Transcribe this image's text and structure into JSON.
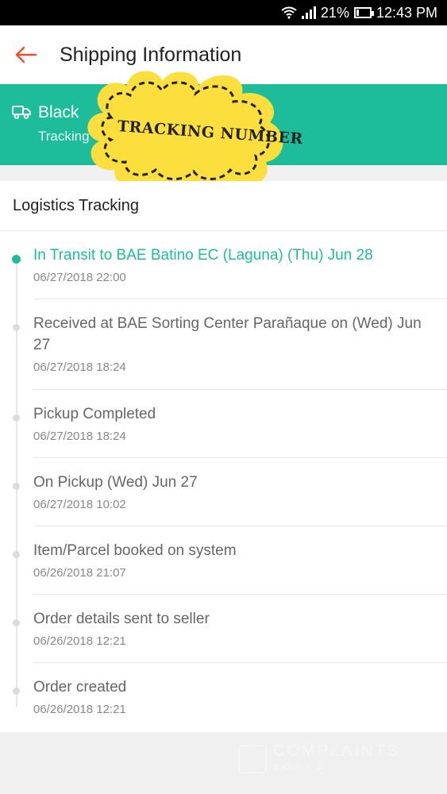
{
  "status_bar": {
    "battery": "21%",
    "time": "12:43 PM",
    "battery_level": 0.21
  },
  "app_bar": {
    "title": "Shipping Information",
    "back_icon": "arrow-left-icon"
  },
  "shipment": {
    "courier": "Black",
    "tracking_label": "Tracking",
    "icon": "truck-icon"
  },
  "sticker": {
    "text": "TRACKING NUMBER"
  },
  "logistics": {
    "header": "Logistics Tracking",
    "events": [
      {
        "status": "In Transit to BAE Batino EC (Laguna) (Thu) Jun 28",
        "time": "06/27/2018 22:00",
        "current": true
      },
      {
        "status": "Received at BAE Sorting Center Parañaque on (Wed) Jun 27",
        "time": "06/27/2018 18:24",
        "current": false
      },
      {
        "status": "Pickup Completed",
        "time": "06/27/2018 18:24",
        "current": false
      },
      {
        "status": "On Pickup (Wed) Jun 27",
        "time": "06/27/2018 10:02",
        "current": false
      },
      {
        "status": "Item/Parcel booked on system",
        "time": "06/26/2018 21:07",
        "current": false
      },
      {
        "status": "Order details sent to seller",
        "time": "06/26/2018 12:21",
        "current": false
      },
      {
        "status": "Order created",
        "time": "06/26/2018 12:21",
        "current": false
      }
    ]
  },
  "watermark": {
    "line1": "COMPLAINTS",
    "line2": "BOARD"
  },
  "colors": {
    "accent": "#1dbd9c",
    "back_arrow": "#ee4d2d"
  }
}
